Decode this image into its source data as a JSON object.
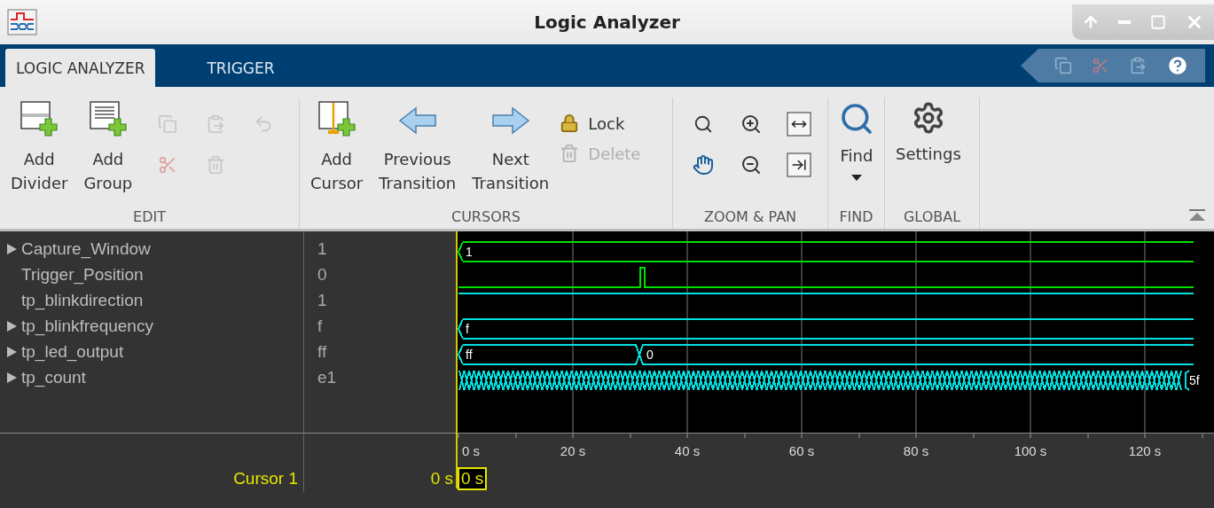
{
  "window": {
    "title": "Logic Analyzer"
  },
  "tabs": [
    {
      "label": "LOGIC ANALYZER",
      "selected": true
    },
    {
      "label": "TRIGGER",
      "selected": false
    }
  ],
  "quick_access": [
    {
      "disabled": true
    },
    {
      "disabled": true
    },
    {
      "disabled": true
    },
    {
      "disabled": false
    }
  ],
  "toolstrip": {
    "sections": [
      {
        "label": "EDIT",
        "items": [
          {
            "kind": "large",
            "label": "Add Divider",
            "disabled": false
          },
          {
            "kind": "large",
            "label": "Add Group",
            "disabled": false
          },
          {
            "kind": "grid",
            "buttons": [
              {
                "disabled": true
              },
              {
                "disabled": true
              },
              {
                "disabled": true
              },
              {
                "disabled": true
              },
              {
                "disabled": true
              }
            ]
          }
        ]
      },
      {
        "label": "CURSORS",
        "items": [
          {
            "kind": "large",
            "label": "Add Cursor",
            "disabled": false
          },
          {
            "kind": "large",
            "label": "Previous Transition",
            "disabled": false
          },
          {
            "kind": "large",
            "label": "Next Transition",
            "disabled": false
          },
          {
            "kind": "stack",
            "buttons": [
              {
                "label": "Lock",
                "disabled": false
              },
              {
                "label": "Delete",
                "disabled": true
              }
            ]
          }
        ]
      },
      {
        "label": "ZOOM & PAN",
        "items": [
          {
            "kind": "grid",
            "buttons": [
              {
                "disabled": false
              },
              {
                "disabled": false
              },
              {
                "disabled": false
              },
              {
                "disabled": false
              },
              {
                "disabled": false
              },
              {
                "disabled": false
              }
            ]
          }
        ]
      },
      {
        "label": "FIND",
        "items": [
          {
            "kind": "dropdown",
            "label": "Find",
            "disabled": false
          }
        ]
      },
      {
        "label": "GLOBAL",
        "items": [
          {
            "kind": "large",
            "label": "Settings",
            "disabled": false
          }
        ]
      }
    ]
  },
  "signals": [
    {
      "name": "Capture_Window",
      "value": "1",
      "expandable": true,
      "kind": "bus",
      "color": "#00e000",
      "labels": [
        "1"
      ]
    },
    {
      "name": "Trigger_Position",
      "value": "0",
      "expandable": false,
      "kind": "pulse",
      "color": "#00e000"
    },
    {
      "name": "tp_blinkdirection",
      "value": "1",
      "expandable": false,
      "kind": "high",
      "color": "#00e0e0"
    },
    {
      "name": "tp_blinkfrequency",
      "value": "f",
      "expandable": true,
      "kind": "bus",
      "color": "#00e0e0",
      "labels": [
        "f"
      ]
    },
    {
      "name": "tp_led_output",
      "value": "ff",
      "expandable": true,
      "kind": "bus",
      "color": "#00e0e0",
      "labels": [
        "ff",
        "0"
      ]
    },
    {
      "name": "tp_count",
      "value": "e1",
      "expandable": true,
      "kind": "toggling",
      "color": "#00e0e0",
      "labels": [
        "5f"
      ]
    }
  ],
  "axis": {
    "ticks": [
      "0 s",
      "20 s",
      "40 s",
      "60 s",
      "80 s",
      "100 s",
      "120 s"
    ]
  },
  "cursor": {
    "label": "Cursor 1",
    "value": "0 s",
    "marker": "0 s"
  }
}
